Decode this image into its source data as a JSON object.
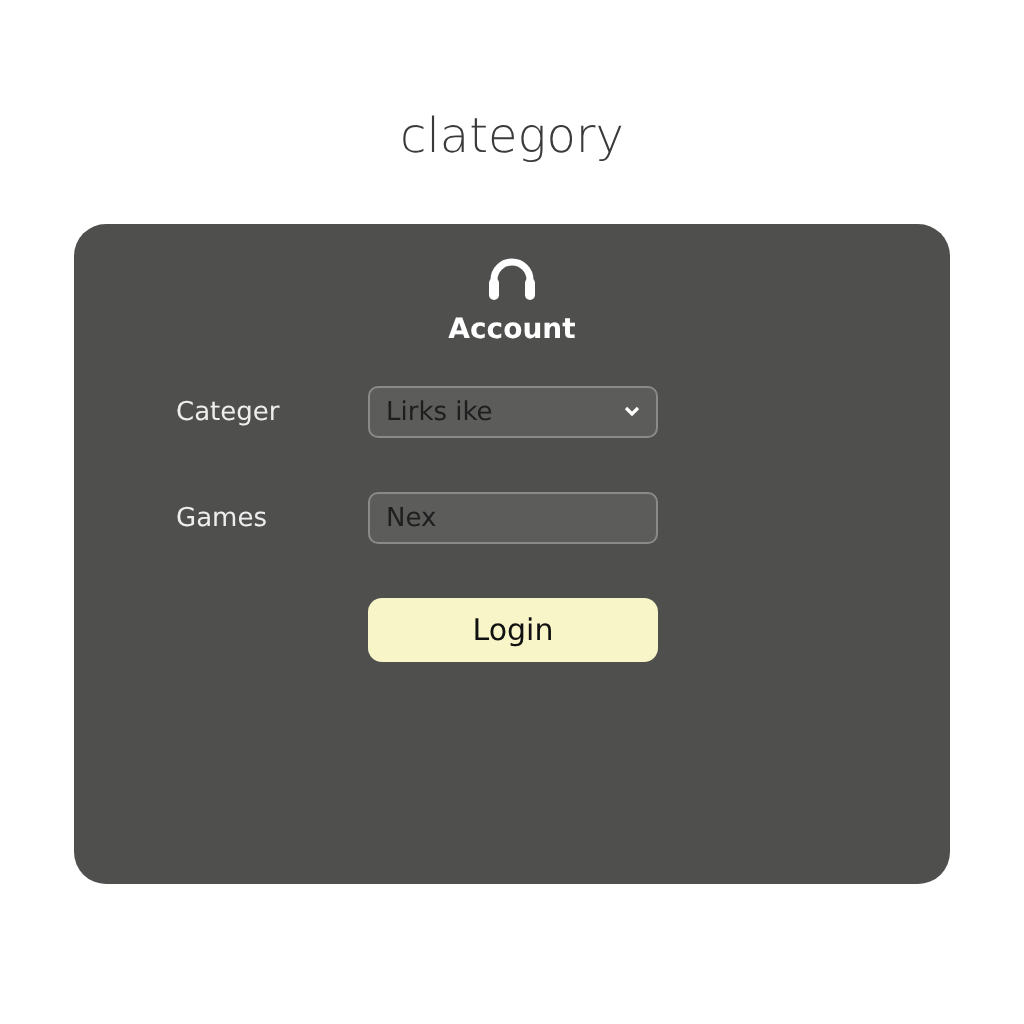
{
  "page_title": "clategory",
  "card": {
    "title": "Account",
    "fields": [
      {
        "kind": "select",
        "label": "Categer",
        "value": "Lirks ike"
      },
      {
        "kind": "text",
        "label": "Games",
        "value": "Nex"
      }
    ],
    "button": "Login"
  }
}
